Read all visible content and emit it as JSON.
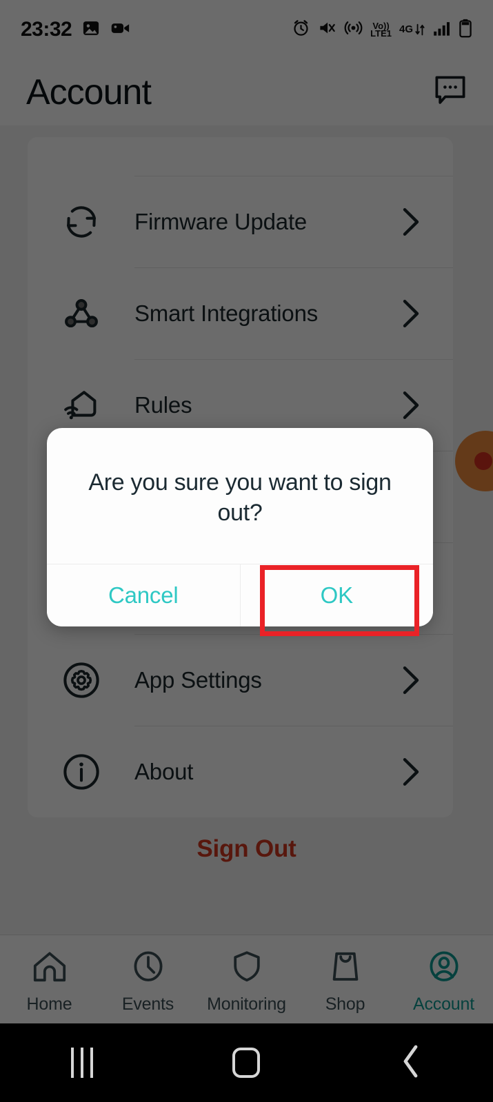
{
  "status_bar": {
    "time": "23:32",
    "left_icons": [
      "image-icon",
      "video-camera-icon"
    ],
    "right_icons": [
      "alarm-icon",
      "mute-vibrate-icon",
      "hotspot-icon",
      "volte-icon",
      "network-4g-icon",
      "signal-bars-icon",
      "battery-icon"
    ],
    "volte_top": "Vo))",
    "volte_bottom": "LTE1",
    "network_label": "4G"
  },
  "header": {
    "title": "Account",
    "action_icon": "chat-bubble-icon"
  },
  "settings_list": [
    {
      "label": "Firmware Update",
      "icon": "sync-refresh-icon"
    },
    {
      "label": "Smart Integrations",
      "icon": "node-graph-icon"
    },
    {
      "label": "Rules",
      "icon": "smart-home-wifi-icon"
    },
    {
      "label": "App Settings",
      "icon": "gear-icon"
    },
    {
      "label": "About",
      "icon": "info-icon"
    }
  ],
  "sign_out_label": "Sign Out",
  "bottom_nav": {
    "items": [
      {
        "label": "Home",
        "icon": "home-icon",
        "active": false
      },
      {
        "label": "Events",
        "icon": "clock-icon",
        "active": false
      },
      {
        "label": "Monitoring",
        "icon": "shield-icon",
        "active": false
      },
      {
        "label": "Shop",
        "icon": "shopping-bag-icon",
        "active": false
      },
      {
        "label": "Account",
        "icon": "user-circle-icon",
        "active": true
      }
    ]
  },
  "dialog": {
    "message": "Are you sure you want to sign out?",
    "cancel_label": "Cancel",
    "ok_label": "OK"
  },
  "android_nav": {
    "recents": "recents-icon",
    "home": "home-square-icon",
    "back": "back-chevron-icon"
  },
  "colors": {
    "accent_teal": "#2ec8c4",
    "sign_out_red": "#d1371f",
    "highlight_red": "#ea2227",
    "fab_orange": "#ef8b3c",
    "fab_dot_red": "#d6301f",
    "nav_active": "#0f9b94"
  }
}
